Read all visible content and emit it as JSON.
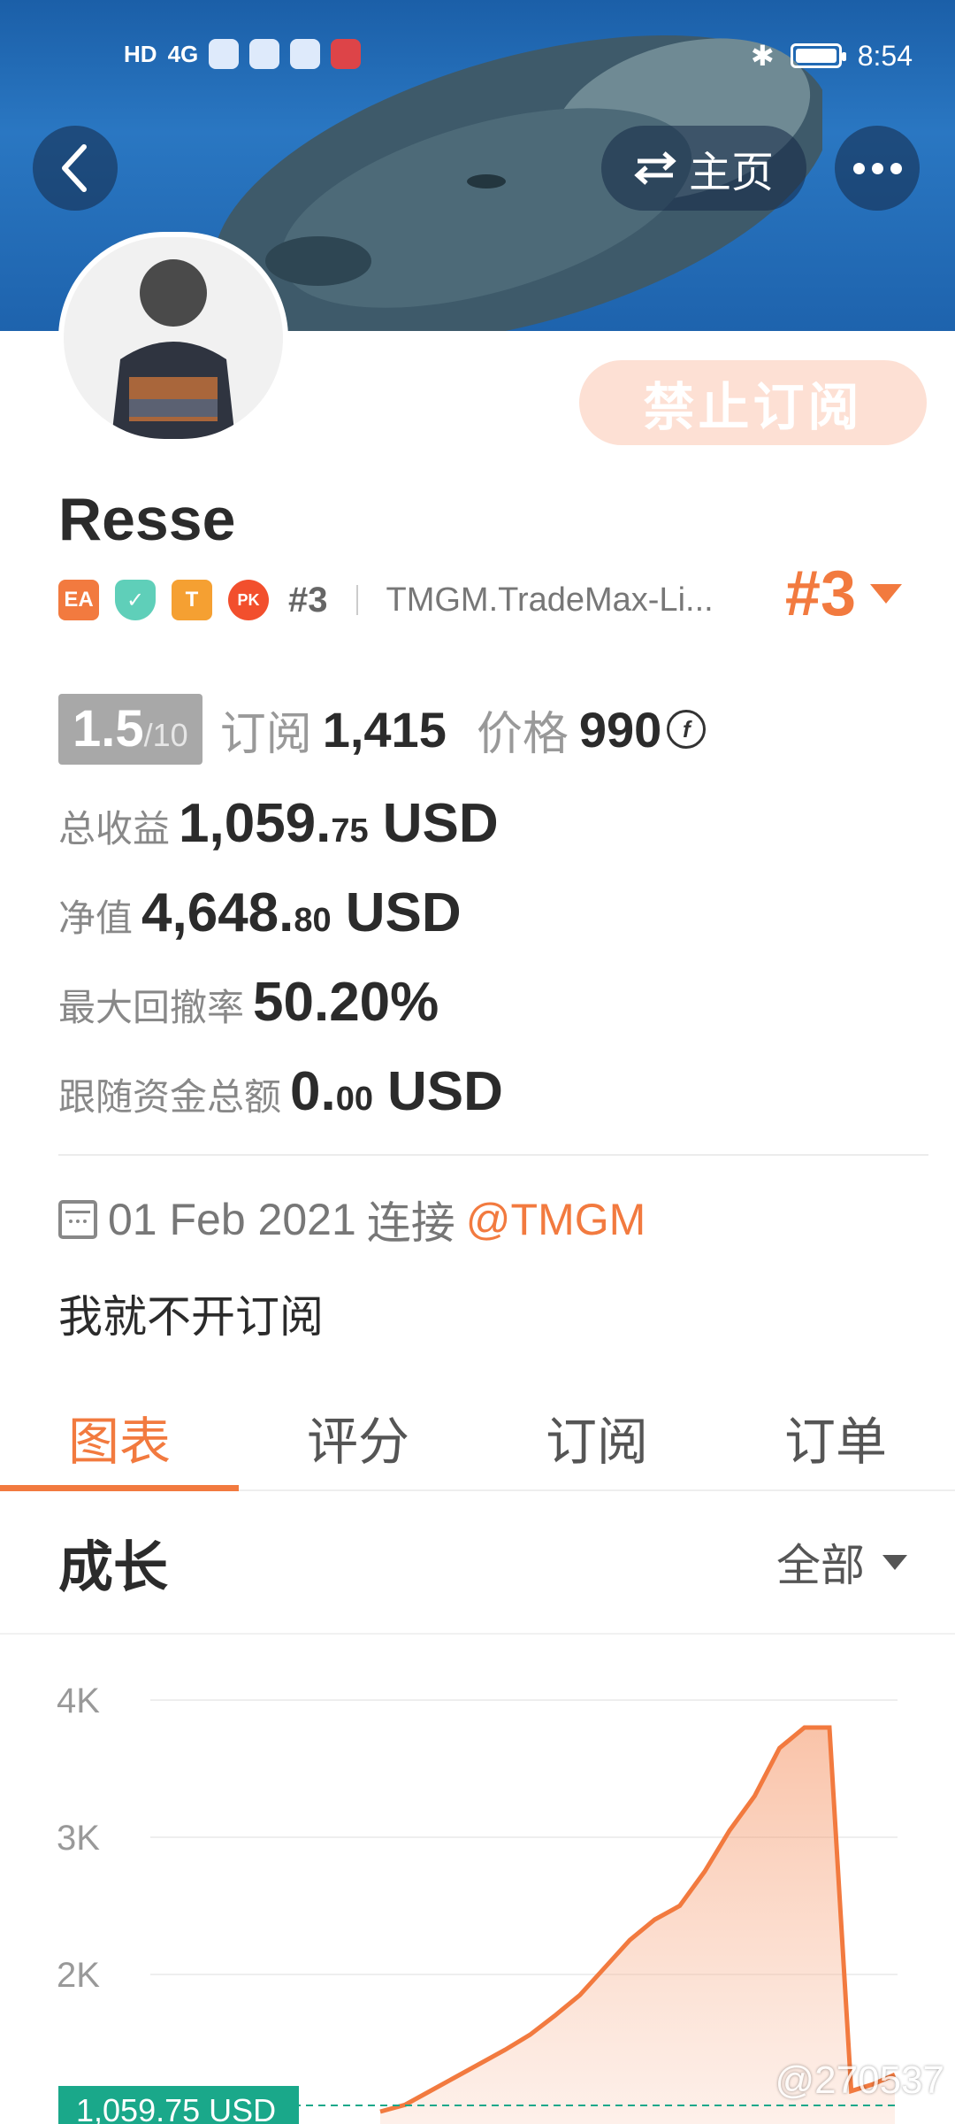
{
  "status_bar": {
    "left_text": "HD",
    "network": "4G",
    "time": "8:54"
  },
  "header": {
    "home_label": "主页",
    "ban_button": "禁止订阅"
  },
  "profile": {
    "name": "Resse",
    "badges": [
      "EA",
      "T",
      "PK"
    ],
    "rank_small": "#3",
    "broker": "TMGM.TradeMax-Li...",
    "rank_big": "#3"
  },
  "stats": {
    "score": "1.5",
    "score_max": "/10",
    "subscribe_label": "订阅",
    "subscribe_value": "1,415",
    "price_label": "价格",
    "price_value": "990",
    "coin_symbol": "f",
    "total_profit_label": "总收益",
    "total_profit_int": "1,059.",
    "total_profit_dec": "75",
    "total_profit_unit": "USD",
    "equity_label": "净值",
    "equity_int": "4,648.",
    "equity_dec": "80",
    "equity_unit": "USD",
    "drawdown_label": "最大回撤率",
    "drawdown_value": "50.20%",
    "follow_label": "跟随资金总额",
    "follow_int": "0.",
    "follow_dec": "00",
    "follow_unit": "USD"
  },
  "connect": {
    "date": "01 Feb 2021",
    "text": "连接",
    "link": "@TMGM"
  },
  "bio": "我就不开订阅",
  "tabs": [
    "图表",
    "评分",
    "订阅",
    "订单"
  ],
  "section": {
    "title": "成长",
    "filter": "全部"
  },
  "watermark": "@270537",
  "colors": {
    "accent": "#f27a3f",
    "chart_fill": "#fbd5c3",
    "tag": "#1aa88a"
  },
  "chart_data": {
    "type": "area",
    "y_ticks": [
      "4K",
      "3K",
      "2K"
    ],
    "ylim": [
      0,
      4000
    ],
    "marker_label": "1,059.75 USD",
    "marker_value": 1059.75,
    "series": [
      {
        "values": [
          1000,
          1050,
          1150,
          1250,
          1350,
          1450,
          1560,
          1700,
          1850,
          2050,
          2250,
          2400,
          2500,
          2750,
          3050,
          3300,
          3650,
          3800,
          3800,
          1150,
          1200,
          1270
        ]
      }
    ]
  }
}
